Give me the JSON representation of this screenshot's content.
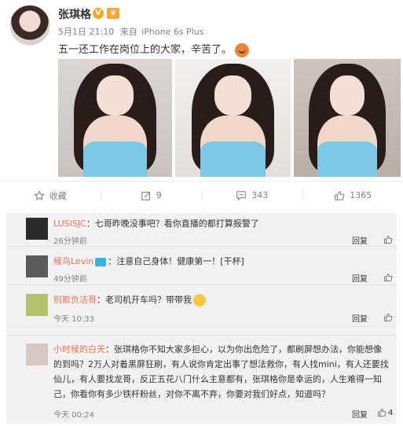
{
  "post": {
    "author": "张琪格",
    "verified_badge": "V",
    "date": "5月1日 21:10",
    "source_prefix": "来自",
    "source": "iPhone 6s Plus",
    "text": "五一还工作在岗位上的大家，辛苦了。",
    "footer": {
      "favorite_label": "收藏",
      "repost_count": "9",
      "comment_count": "343",
      "like_count": "1365"
    }
  },
  "comments": [
    {
      "user": "LUSISJC",
      "text": "：七哥昨晚没事吧？看你直播的都打算报警了",
      "time": "26分钟前",
      "reply_label": "回复"
    },
    {
      "user": "候鸟Levin",
      "text": "：注意自己身体！健康第一！[干杯]",
      "time": "49分钟前",
      "reply_label": "回复"
    },
    {
      "user": "别欺负洁哥",
      "text": "：老司机开车吗？带带我",
      "time": "今天 10:33",
      "reply_label": "回复"
    },
    {
      "user": "小时候的白天",
      "text_lines": [
        "：张琪格你不知大家多担心，以为你出危险了，都刷屏想办法，你能想像",
        "的到吗？2万人对着黑屏狂刷，有人说你肯定出事了想法救你，有人找mini，有人还要找",
        "仙儿，有人要找龙哥，反正五花八门什么主意都有，张琪格你是幸运的，人生难得一知",
        "己，你看你有多少铁杆粉丝，对你不离不弃，你要对我们好点，知道吗？"
      ],
      "time": "今天 00:24",
      "reply_label": "回复",
      "like_count": "4"
    }
  ],
  "colors": {
    "username": "#eb7350",
    "meta": "#808080",
    "comments_bg": "#f2f2f5"
  }
}
